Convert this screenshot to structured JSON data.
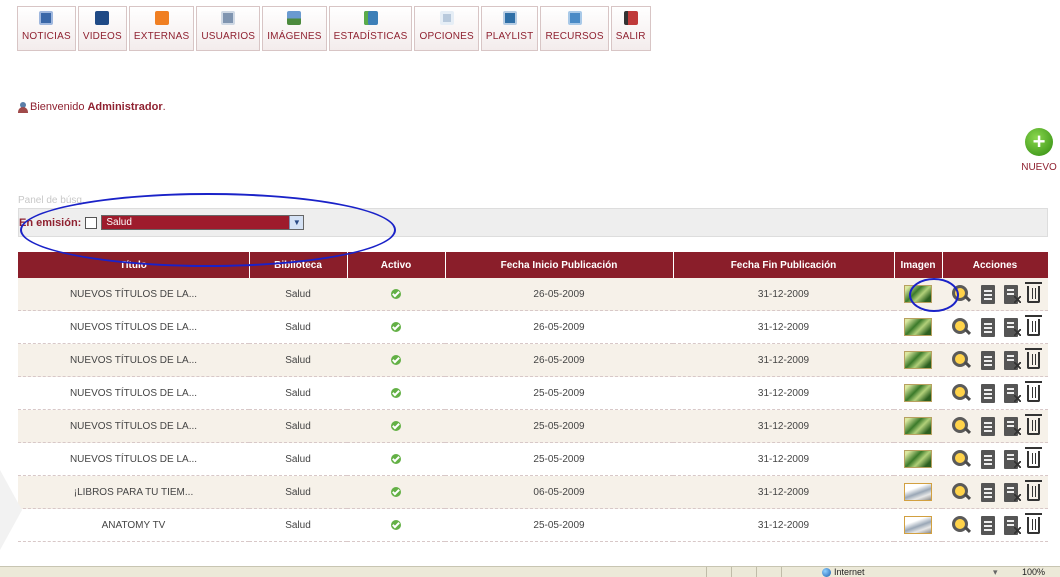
{
  "nav": {
    "items": [
      {
        "label": "NOTICIAS",
        "icon": "news-icon"
      },
      {
        "label": "VIDEOS",
        "icon": "video-icon"
      },
      {
        "label": "EXTERNAS",
        "icon": "rss-icon"
      },
      {
        "label": "USUARIOS",
        "icon": "users-icon"
      },
      {
        "label": "IMÁGENES",
        "icon": "images-icon"
      },
      {
        "label": "ESTADÍSTICAS",
        "icon": "statistics-icon"
      },
      {
        "label": "OPCIONES",
        "icon": "options-icon"
      },
      {
        "label": "PLAYLIST",
        "icon": "playlist-icon"
      },
      {
        "label": "RECURSOS",
        "icon": "resources-icon"
      },
      {
        "label": "SALIR",
        "icon": "exit-icon"
      }
    ]
  },
  "welcome": {
    "text": "Bienvenido",
    "name": "Administrador",
    "dot": "."
  },
  "new_button": {
    "label": "NUEVO"
  },
  "search": {
    "panel_title": "Panel de búsq...",
    "emission_label": "En emisión:",
    "emission_checked": false,
    "library_selected": "Salud"
  },
  "table": {
    "headers": [
      "Título",
      "Biblioteca",
      "Activo",
      "Fecha Inicio Publicación",
      "Fecha Fin Publicación",
      "Imagen",
      "Acciones"
    ],
    "rows": [
      {
        "title": "NUEVOS TÍTULOS DE LA...",
        "library": "Salud",
        "active": true,
        "start": "26-05-2009",
        "end": "31-12-2009",
        "image": "green"
      },
      {
        "title": "NUEVOS TÍTULOS DE LA...",
        "library": "Salud",
        "active": true,
        "start": "26-05-2009",
        "end": "31-12-2009",
        "image": "green"
      },
      {
        "title": "NUEVOS TÍTULOS DE LA...",
        "library": "Salud",
        "active": true,
        "start": "26-05-2009",
        "end": "31-12-2009",
        "image": "green"
      },
      {
        "title": "NUEVOS TÍTULOS DE LA...",
        "library": "Salud",
        "active": true,
        "start": "25-05-2009",
        "end": "31-12-2009",
        "image": "green"
      },
      {
        "title": "NUEVOS TÍTULOS DE LA...",
        "library": "Salud",
        "active": true,
        "start": "25-05-2009",
        "end": "31-12-2009",
        "image": "green"
      },
      {
        "title": "NUEVOS TÍTULOS DE LA...",
        "library": "Salud",
        "active": true,
        "start": "25-05-2009",
        "end": "31-12-2009",
        "image": "green"
      },
      {
        "title": "¡LIBROS PARA TU TIEM...",
        "library": "Salud",
        "active": true,
        "start": "06-05-2009",
        "end": "31-12-2009",
        "image": "paper"
      },
      {
        "title": "ANATOMY TV",
        "library": "Salud",
        "active": true,
        "start": "25-05-2009",
        "end": "31-12-2009",
        "image": "paper"
      }
    ]
  },
  "statusbar": {
    "zone": "Internet",
    "zoom": "100%"
  },
  "colors": {
    "brand": "#8a1e2a",
    "annotation": "#1a22c8"
  }
}
